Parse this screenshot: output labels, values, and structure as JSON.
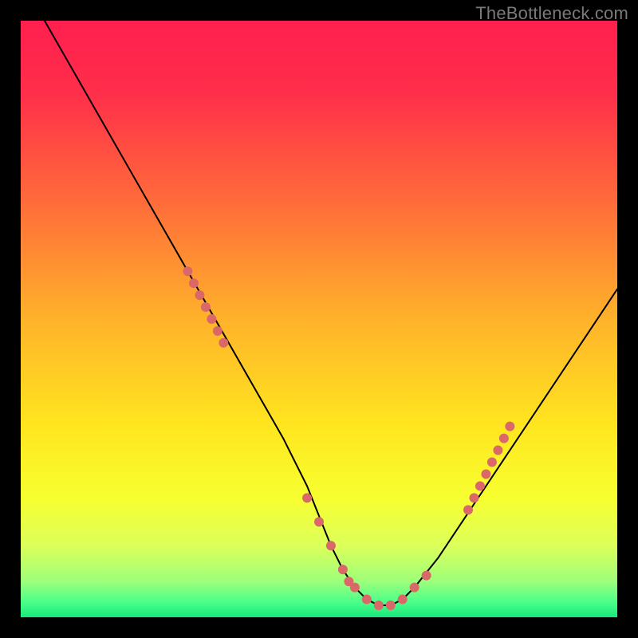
{
  "watermark": "TheBottleneck.com",
  "chart_data": {
    "type": "line",
    "title": "",
    "xlabel": "",
    "ylabel": "",
    "xlim": [
      0,
      100
    ],
    "ylim": [
      0,
      100
    ],
    "grid": false,
    "background_gradient": {
      "type": "vertical",
      "stops": [
        {
          "offset": 0.0,
          "color": "#ff1f4f"
        },
        {
          "offset": 0.12,
          "color": "#ff2e4a"
        },
        {
          "offset": 0.3,
          "color": "#ff6a3a"
        },
        {
          "offset": 0.5,
          "color": "#ffb22a"
        },
        {
          "offset": 0.68,
          "color": "#ffe61f"
        },
        {
          "offset": 0.8,
          "color": "#f7ff30"
        },
        {
          "offset": 0.88,
          "color": "#dcff5a"
        },
        {
          "offset": 0.94,
          "color": "#9dff7a"
        },
        {
          "offset": 0.975,
          "color": "#4aff8a"
        },
        {
          "offset": 1.0,
          "color": "#17e87a"
        }
      ]
    },
    "series": [
      {
        "name": "bottleneck-curve",
        "color": "#000000",
        "width": 2,
        "x": [
          4,
          8,
          12,
          16,
          20,
          24,
          28,
          32,
          36,
          40,
          44,
          48,
          50,
          52,
          54,
          56,
          58,
          60,
          62,
          64,
          66,
          70,
          74,
          78,
          82,
          86,
          90,
          94,
          98,
          100
        ],
        "y": [
          100,
          93,
          86,
          79,
          72,
          65,
          58,
          51,
          44,
          37,
          30,
          22,
          17,
          12,
          8,
          5,
          3,
          2,
          2,
          3,
          5,
          10,
          16,
          22,
          28,
          34,
          40,
          46,
          52,
          55
        ]
      }
    ],
    "markers": {
      "name": "highlight-dots",
      "color": "#db6868",
      "radius_px": 6,
      "points": [
        {
          "x": 28,
          "y": 58
        },
        {
          "x": 29,
          "y": 56
        },
        {
          "x": 30,
          "y": 54
        },
        {
          "x": 31,
          "y": 52
        },
        {
          "x": 32,
          "y": 50
        },
        {
          "x": 33,
          "y": 48
        },
        {
          "x": 34,
          "y": 46
        },
        {
          "x": 48,
          "y": 20
        },
        {
          "x": 50,
          "y": 16
        },
        {
          "x": 52,
          "y": 12
        },
        {
          "x": 54,
          "y": 8
        },
        {
          "x": 55,
          "y": 6
        },
        {
          "x": 56,
          "y": 5
        },
        {
          "x": 58,
          "y": 3
        },
        {
          "x": 60,
          "y": 2
        },
        {
          "x": 62,
          "y": 2
        },
        {
          "x": 64,
          "y": 3
        },
        {
          "x": 66,
          "y": 5
        },
        {
          "x": 68,
          "y": 7
        },
        {
          "x": 75,
          "y": 18
        },
        {
          "x": 76,
          "y": 20
        },
        {
          "x": 77,
          "y": 22
        },
        {
          "x": 78,
          "y": 24
        },
        {
          "x": 79,
          "y": 26
        },
        {
          "x": 80,
          "y": 28
        },
        {
          "x": 81,
          "y": 30
        },
        {
          "x": 82,
          "y": 32
        }
      ]
    }
  }
}
